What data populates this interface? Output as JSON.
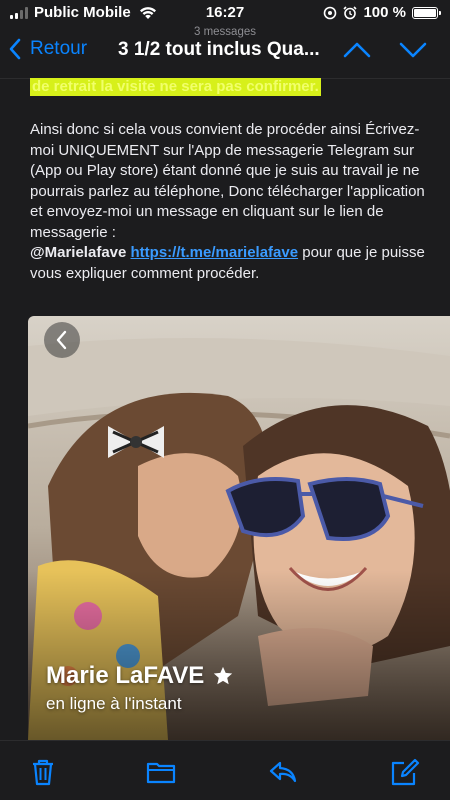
{
  "status_bar": {
    "carrier": "Public Mobile",
    "time": "16:27",
    "battery": "100 %"
  },
  "nav": {
    "message_count": "3 messages",
    "back_label": "Retour",
    "title": "3 1/2 tout inclus Qua..."
  },
  "email": {
    "highlight": "de retrait la visite ne sera pas confirmer.",
    "paragraph_pre": "Ainsi donc si cela vous convient de procéder ainsi Écrivez-moi UNIQUEMENT sur l'App de messagerie Telegram sur (App ou Play store) étant donné que je suis au travail je ne pourrais parlez au téléphone, Donc télécharger l'application et envoyez-moi un message en cliquant sur le lien de messagerie :",
    "handle": "@Marielafave",
    "link": "https://t.me/marielafave",
    "paragraph_post": "pour que je puisse vous expliquer comment procéder."
  },
  "profile_card": {
    "name": "Marie LaFAVE",
    "status": "en ligne à l'instant"
  },
  "toolbar": {
    "items": [
      "trash",
      "folder",
      "reply",
      "compose"
    ]
  },
  "colors": {
    "accent": "#0a84ff",
    "highlight_bg": "#d7f01a",
    "link": "#3a9bff"
  }
}
